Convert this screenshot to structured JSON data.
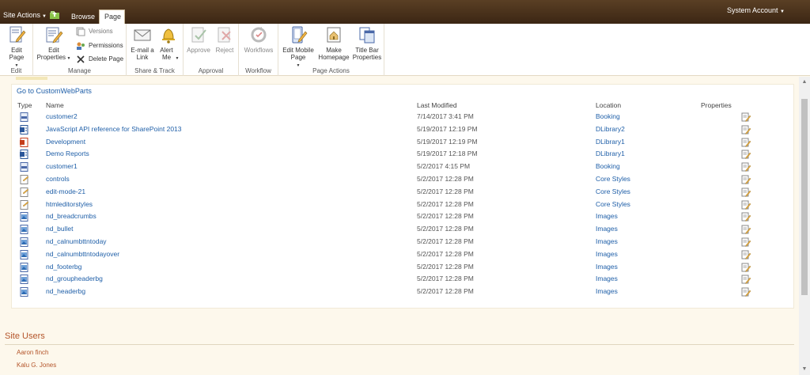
{
  "topbar": {
    "site_actions": "Site Actions",
    "tabs": [
      {
        "label": "Browse"
      },
      {
        "label": "Page"
      }
    ],
    "system_account": "System Account"
  },
  "ribbon": {
    "groups": [
      {
        "label": "Edit",
        "buttons": [
          {
            "label": "Edit Page",
            "icon": "edit-page-icon"
          }
        ]
      },
      {
        "label": "Manage",
        "buttons": [
          {
            "label": "Edit Properties",
            "icon": "edit-properties-icon"
          }
        ],
        "small": [
          {
            "label": "Versions",
            "icon": "versions-icon"
          },
          {
            "label": "Permissions",
            "icon": "permissions-icon"
          },
          {
            "label": "Delete Page",
            "icon": "delete-icon"
          }
        ]
      },
      {
        "label": "Share & Track",
        "buttons": [
          {
            "label": "E-mail a Link",
            "icon": "email-icon"
          },
          {
            "label": "Alert Me",
            "icon": "bell-icon"
          }
        ]
      },
      {
        "label": "Approval",
        "buttons": [
          {
            "label": "Approve",
            "icon": "approve-icon"
          },
          {
            "label": "Reject",
            "icon": "reject-icon"
          }
        ]
      },
      {
        "label": "Workflow",
        "buttons": [
          {
            "label": "Workflows",
            "icon": "workflows-icon"
          }
        ]
      },
      {
        "label": "Page Actions",
        "buttons": [
          {
            "label": "Edit Mobile Page",
            "icon": "mobile-page-icon"
          },
          {
            "label": "Make Homepage",
            "icon": "home-icon"
          },
          {
            "label": "Title Bar Properties",
            "icon": "title-bar-icon"
          }
        ]
      }
    ]
  },
  "webpart": {
    "goto_link": "Go to CustomWebParts",
    "headers": {
      "type": "Type",
      "name": "Name",
      "modified": "Last Modified",
      "location": "Location",
      "properties": "Properties"
    },
    "rows": [
      {
        "icon": "aspx-file-icon",
        "name": "customer2",
        "modified": "7/14/2017 3:41 PM",
        "location": "Booking"
      },
      {
        "icon": "word-doc-icon",
        "name": "JavaScript API reference for SharePoint 2013",
        "modified": "5/19/2017 12:19 PM",
        "location": "DLibrary2"
      },
      {
        "icon": "powerpoint-icon",
        "name": "Development",
        "modified": "5/19/2017 12:19 PM",
        "location": "DLibrary1"
      },
      {
        "icon": "word-doc-icon",
        "name": "Demo Reports",
        "modified": "5/19/2017 12:18 PM",
        "location": "DLibrary1"
      },
      {
        "icon": "aspx-file-icon",
        "name": "customer1",
        "modified": "5/2/2017 4:15 PM",
        "location": "Booking"
      },
      {
        "icon": "css-file-icon",
        "name": "controls",
        "modified": "5/2/2017 12:28 PM",
        "location": "Core Styles"
      },
      {
        "icon": "css-file-icon",
        "name": "edit-mode-21",
        "modified": "5/2/2017 12:28 PM",
        "location": "Core Styles"
      },
      {
        "icon": "css-file-icon",
        "name": "htmleditorstyles",
        "modified": "5/2/2017 12:28 PM",
        "location": "Core Styles"
      },
      {
        "icon": "image-file-icon",
        "name": "nd_breadcrumbs",
        "modified": "5/2/2017 12:28 PM",
        "location": "Images"
      },
      {
        "icon": "image-file-icon",
        "name": "nd_bullet",
        "modified": "5/2/2017 12:28 PM",
        "location": "Images"
      },
      {
        "icon": "image-file-icon",
        "name": "nd_calnumbttntoday",
        "modified": "5/2/2017 12:28 PM",
        "location": "Images"
      },
      {
        "icon": "image-file-icon",
        "name": "nd_calnumbttntodayover",
        "modified": "5/2/2017 12:28 PM",
        "location": "Images"
      },
      {
        "icon": "image-file-icon",
        "name": "nd_footerbg",
        "modified": "5/2/2017 12:28 PM",
        "location": "Images"
      },
      {
        "icon": "image-file-icon",
        "name": "nd_groupheaderbg",
        "modified": "5/2/2017 12:28 PM",
        "location": "Images"
      },
      {
        "icon": "image-file-icon",
        "name": "nd_headerbg",
        "modified": "5/2/2017 12:28 PM",
        "location": "Images"
      }
    ]
  },
  "site_users": {
    "title": "Site Users",
    "users": [
      "Aaron finch",
      "Kalu G. Jones"
    ]
  },
  "colors": {
    "topbar": "#4a321c",
    "link": "#1f5fa8",
    "accent": "#b4552a"
  }
}
